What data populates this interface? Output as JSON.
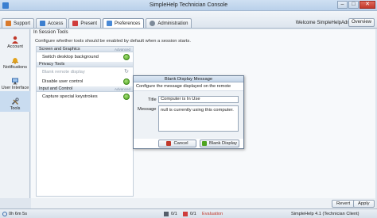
{
  "window": {
    "title": "SimpleHelp Technician Console",
    "minimize": "–",
    "maximize": "□",
    "close": "✕"
  },
  "toolbar": {
    "tabs": [
      {
        "label": "Support",
        "icon": "support-icon",
        "color": "#d97a2b"
      },
      {
        "label": "Access",
        "icon": "access-icon",
        "color": "#3c7fcf"
      },
      {
        "label": "Present",
        "icon": "present-icon",
        "color": "#cf3c3c"
      },
      {
        "label": "Preferences",
        "icon": "preferences-icon",
        "color": "#4a8ad6",
        "active": true
      },
      {
        "label": "Administration",
        "icon": "administration-icon",
        "color": "#7d8a99"
      }
    ],
    "welcome_text": "Welcome SimpleHelpAdmin",
    "overview_label": "Overview"
  },
  "sidebar": {
    "items": [
      {
        "label": "Account",
        "icon": "account-icon",
        "color": "#c0392b"
      },
      {
        "label": "Notifications",
        "icon": "bell-icon",
        "color": "#e2a21b"
      },
      {
        "label": "User Interface",
        "icon": "monitor-icon",
        "color": "#3c6fae"
      },
      {
        "label": "Tools",
        "icon": "tools-icon",
        "color": "#555e6a",
        "active": true
      }
    ]
  },
  "main": {
    "section_title": "In Session Tools",
    "section_desc": "Configure whether tools should be enabled by default when a session starts.",
    "groups": [
      {
        "title": "Screen and Graphics",
        "tag": "Advanced",
        "options": [
          {
            "label": "Switch desktop background",
            "state": "enabled"
          }
        ]
      },
      {
        "title": "Privacy Tools",
        "tag": "",
        "options": [
          {
            "label": "Blank remote display",
            "state": "loading"
          },
          {
            "label": "Disable user control",
            "state": "enabled"
          }
        ]
      },
      {
        "title": "Input and Control",
        "tag": "Advanced",
        "options": [
          {
            "label": "Capture special keystrokes",
            "state": "enabled"
          }
        ]
      }
    ]
  },
  "dialog": {
    "title": "Blank Display Message",
    "description": "Configure the message displayed on the remote monitor",
    "title_label": "Title",
    "title_value": "Computer is In Use",
    "message_label": "Message",
    "message_value": "null is currently using this computer.",
    "cancel_label": "Cancel",
    "confirm_label": "Blank Display"
  },
  "bottom": {
    "revert_label": "Revert",
    "apply_label": "Apply"
  },
  "status": {
    "uptime": "0h 6m 5s",
    "sessions": "0/1",
    "alerts": "0/1",
    "license": "Evaluation",
    "version": "SimpleHelp 4.1 (Technician Client)",
    "accent_red": "#c0392b",
    "accent_green": "#4ea420"
  }
}
